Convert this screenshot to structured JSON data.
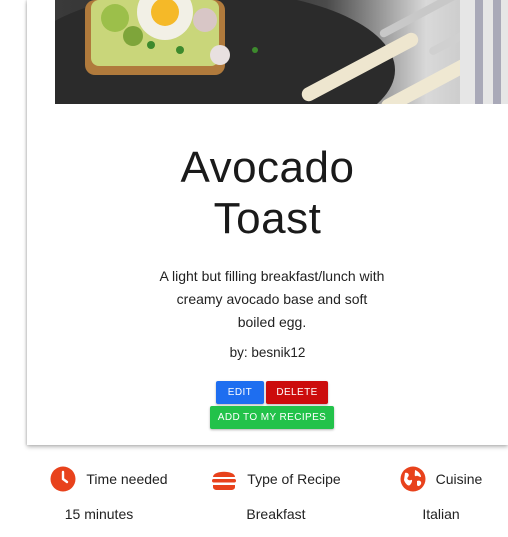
{
  "recipe": {
    "title_line1": "Avocado",
    "title_line2": "Toast",
    "description": "A light but filling breakfast/lunch with creamy avocado base and soft boiled egg.",
    "author": "by: besnik12"
  },
  "actions": {
    "edit_label": "EDIT",
    "delete_label": "DELETE",
    "add_label": "ADD TO MY RECIPES"
  },
  "stats": [
    {
      "icon": "clock-icon",
      "label": "Time needed",
      "value": "15 minutes"
    },
    {
      "icon": "burger-icon",
      "label": "Type of Recipe",
      "value": "Breakfast"
    },
    {
      "icon": "globe-icon",
      "label": "Cuisine",
      "value": "Italian"
    }
  ],
  "colors": {
    "accent_icon": "#e8421c",
    "edit": "#1e6ef0",
    "delete": "#cc0c0c",
    "add": "#22c24a"
  }
}
